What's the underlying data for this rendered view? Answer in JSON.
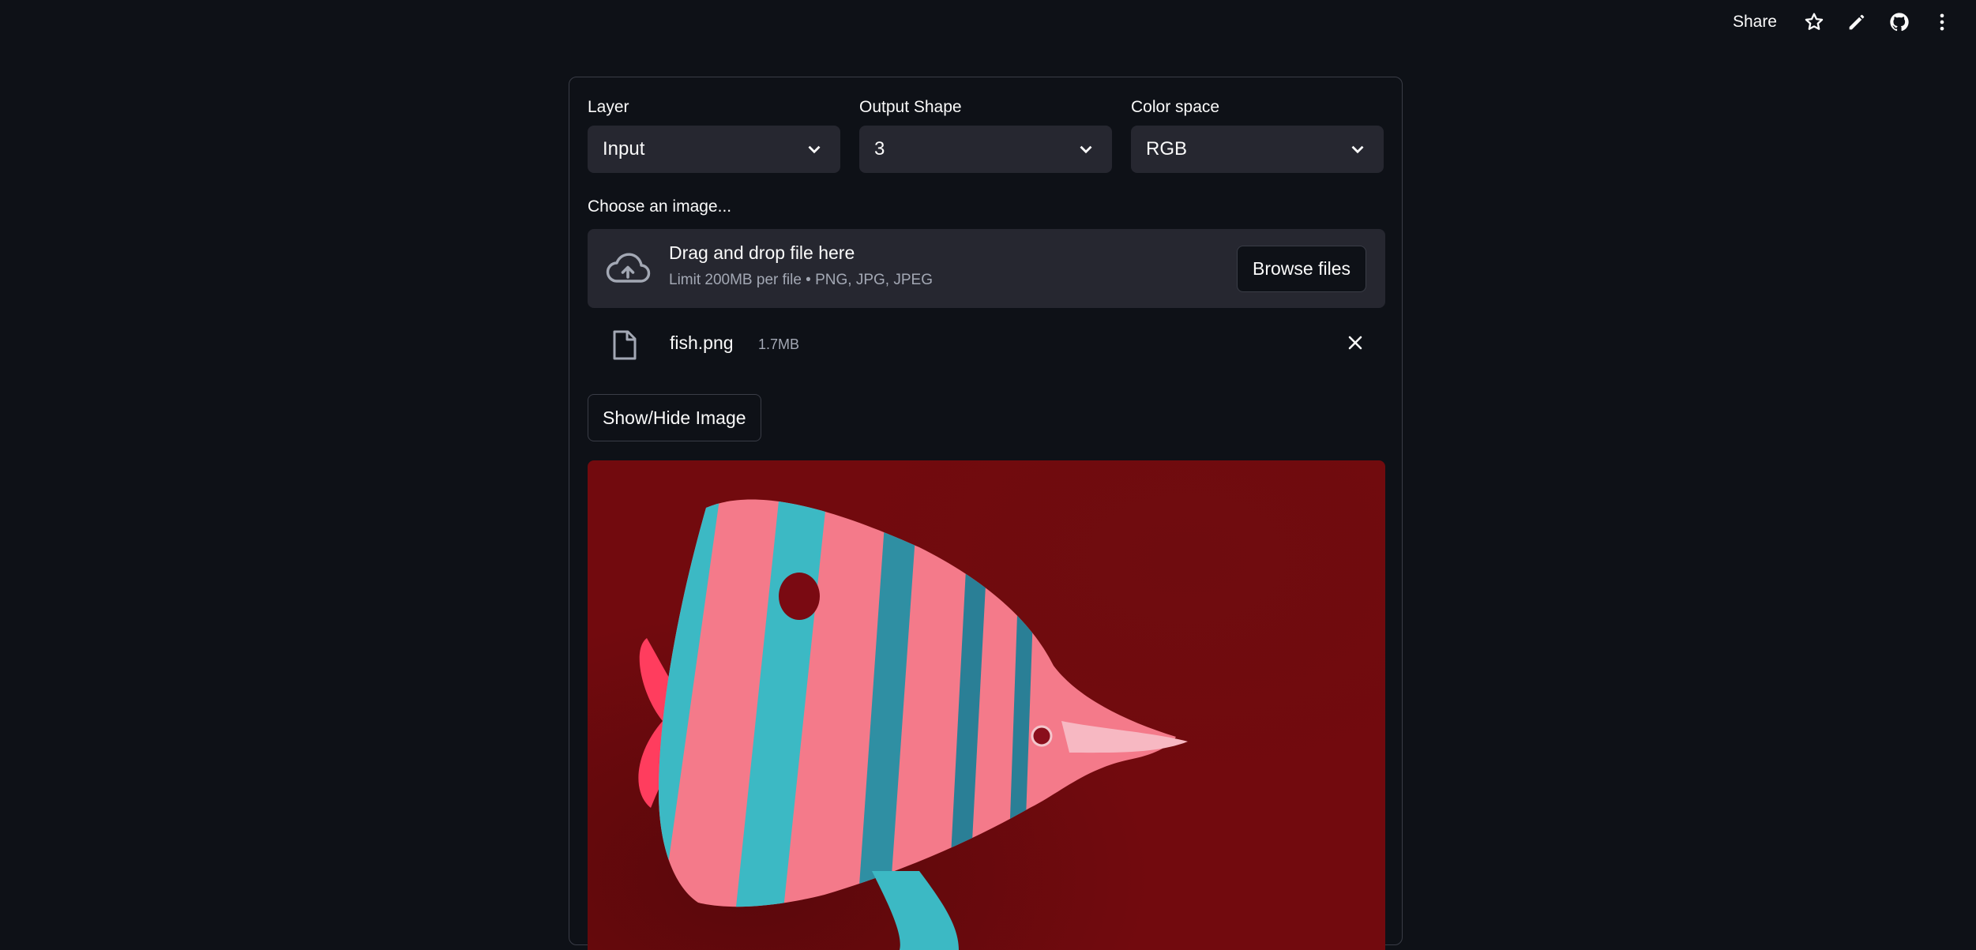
{
  "topbar": {
    "share_label": "Share",
    "icons": [
      "star-icon",
      "pencil-icon",
      "github-icon",
      "more-vertical-icon"
    ]
  },
  "controls": {
    "layer": {
      "label": "Layer",
      "value": "Input"
    },
    "output_shape": {
      "label": "Output Shape",
      "value": "3"
    },
    "color_space": {
      "label": "Color space",
      "value": "RGB"
    }
  },
  "uploader": {
    "label": "Choose an image...",
    "title": "Drag and drop file here",
    "subtitle": "Limit 200MB per file • PNG, JPG, JPEG",
    "browse_label": "Browse files",
    "icon": "cloud-upload-icon"
  },
  "file": {
    "name": "fish.png",
    "size": "1.7MB",
    "icon": "file-icon"
  },
  "toggle_label": "Show/Hide Image",
  "colors": {
    "background": "#0e1117",
    "surface": "#262730",
    "border": "#3a3d47",
    "image_bg": "#720a0e",
    "fish_pink": "#f47a8a",
    "fish_teal": "#3cb9c4"
  }
}
